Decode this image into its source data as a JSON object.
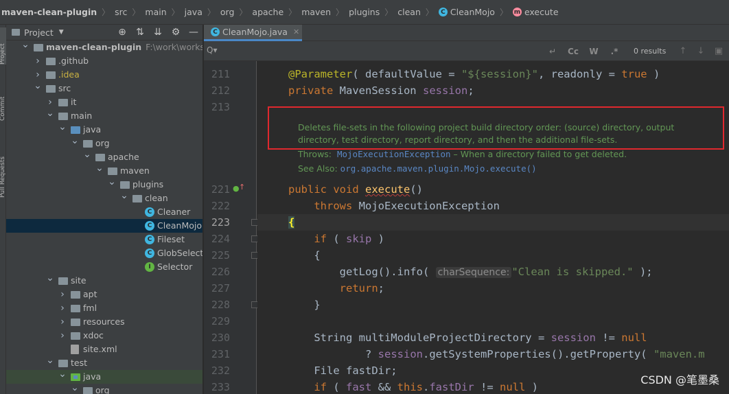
{
  "breadcrumb": {
    "items": [
      "maven-clean-plugin",
      "src",
      "main",
      "java",
      "org",
      "apache",
      "maven",
      "plugins",
      "clean",
      "CleanMojo",
      "execute"
    ]
  },
  "toolstrip": {
    "tabs": [
      "Project",
      "Commit",
      "Pull Requests"
    ]
  },
  "project_panel": {
    "title": "Project",
    "tools": [
      "target-icon",
      "expand-icon",
      "collapse-icon",
      "gear-icon",
      "minimize-icon"
    ],
    "tree": [
      {
        "label": "maven-clean-plugin",
        "hint": "F:\\work\\workspace\\",
        "depth": 0,
        "expanded": true,
        "type": "module"
      },
      {
        "label": ".github",
        "depth": 1,
        "expanded": false,
        "type": "folder"
      },
      {
        "label": ".idea",
        "depth": 1,
        "expanded": false,
        "type": "folder"
      },
      {
        "label": "src",
        "depth": 1,
        "expanded": true,
        "type": "folder"
      },
      {
        "label": "it",
        "depth": 2,
        "expanded": false,
        "type": "folder"
      },
      {
        "label": "main",
        "depth": 2,
        "expanded": true,
        "type": "folder"
      },
      {
        "label": "java",
        "depth": 3,
        "expanded": true,
        "type": "source"
      },
      {
        "label": "org",
        "depth": 4,
        "expanded": true,
        "type": "folder"
      },
      {
        "label": "apache",
        "depth": 5,
        "expanded": true,
        "type": "folder"
      },
      {
        "label": "maven",
        "depth": 6,
        "expanded": true,
        "type": "folder"
      },
      {
        "label": "plugins",
        "depth": 7,
        "expanded": true,
        "type": "folder"
      },
      {
        "label": "clean",
        "depth": 8,
        "expanded": true,
        "type": "folder"
      },
      {
        "label": "Cleaner",
        "depth": 9,
        "type": "class"
      },
      {
        "label": "CleanMojo",
        "depth": 9,
        "type": "class",
        "selected": true
      },
      {
        "label": "Fileset",
        "depth": 9,
        "type": "class"
      },
      {
        "label": "GlobSelector",
        "depth": 9,
        "type": "class"
      },
      {
        "label": "Selector",
        "depth": 9,
        "type": "interface"
      },
      {
        "label": "site",
        "depth": 2,
        "expanded": true,
        "type": "folder"
      },
      {
        "label": "apt",
        "depth": 3,
        "expanded": false,
        "type": "folder"
      },
      {
        "label": "fml",
        "depth": 3,
        "expanded": false,
        "type": "folder"
      },
      {
        "label": "resources",
        "depth": 3,
        "expanded": false,
        "type": "folder"
      },
      {
        "label": "xdoc",
        "depth": 3,
        "expanded": false,
        "type": "folder"
      },
      {
        "label": "site.xml",
        "depth": 3,
        "type": "xml"
      },
      {
        "label": "test",
        "depth": 2,
        "expanded": true,
        "type": "folder"
      },
      {
        "label": "java",
        "depth": 3,
        "expanded": true,
        "type": "testsource",
        "highlight": true
      },
      {
        "label": "org",
        "depth": 4,
        "expanded": true,
        "type": "folder"
      }
    ]
  },
  "editor": {
    "tab_label": "CleanMojo.java",
    "find": {
      "results": "0 results",
      "tools": [
        "Cc",
        "W"
      ]
    },
    "doc": {
      "description": "Deletes file-sets in the following project build directory order: (source) directory, output directory, test directory, report directory, and then the additional file-sets.",
      "throws_label": "Throws:",
      "throws_type": "MojoExecutionException",
      "throws_desc": " – When a directory failed to get deleted.",
      "see_label": "See Also:",
      "see_link": "org.apache.maven.plugin.Mojo.execute()"
    },
    "line_numbers": [
      "211",
      "212",
      "213",
      "221",
      "222",
      "223",
      "224",
      "225",
      "226",
      "227",
      "228",
      "229",
      "230",
      "231",
      "232",
      "233"
    ],
    "hint_label": "charSequence:"
  },
  "watermark": "CSDN @笔墨桑"
}
